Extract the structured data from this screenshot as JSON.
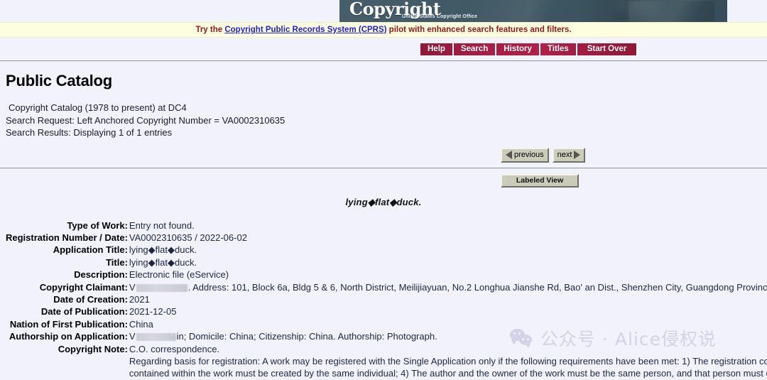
{
  "header": {
    "wordmark": "Copyright",
    "subtitle": "United States Copyright Office",
    "banner_color": "#3c5663"
  },
  "notice": {
    "prefix": "Try the ",
    "link_text": "Copyright Public Records System (CPRS)",
    "suffix": " pilot with enhanced search features and filters.",
    "background": "#fdfddf",
    "text_color": "#8b1a1a",
    "link_color": "#2222cc"
  },
  "nav": {
    "accent": "#a51e44",
    "buttons": [
      {
        "label": "Help"
      },
      {
        "label": "Search"
      },
      {
        "label": "History"
      },
      {
        "label": "Titles"
      },
      {
        "label": "Start Over"
      }
    ]
  },
  "page": {
    "title": "Public Catalog",
    "catalog_line": "Copyright Catalog (1978 to present) at DC4",
    "search_request": "Search Request: Left Anchored Copyright Number = VA0002310635",
    "search_results": "Search Results: Displaying 1 of 1 entries"
  },
  "pager": {
    "previous_label": "previous",
    "next_label": "next",
    "labeled_view": "Labeled View"
  },
  "record": {
    "title": "lying◆flat◆duck.",
    "fields": [
      {
        "label": "Type of Work:",
        "value": "Entry not found."
      },
      {
        "label": "Registration Number / Date:",
        "value": "VA0002310635 / 2022-06-02"
      },
      {
        "label": "Application Title:",
        "value": "lying◆flat◆duck."
      },
      {
        "label": "Title:",
        "value": "lying◆flat◆duck."
      },
      {
        "label": "Description:",
        "value": "Electronic file (eService)"
      },
      {
        "label": "Copyright Claimant:",
        "value_prefix": "V",
        "redacted": true,
        "redact_width": 72,
        "value_suffix": ". Address: 101, Block 6a, Bldg 5 & 6, North District, Meilijiayuan, No.2 Longhua Jianshe Rd, Bao'  an Dist., Shenzhen City, Guangdong Province, China."
      },
      {
        "label": "Date of Creation:",
        "value": "2021"
      },
      {
        "label": "Date of Publication:",
        "value": "2021-12-05"
      },
      {
        "label": "Nation of First Publication:",
        "value": "China"
      },
      {
        "label": "Authorship on Application:",
        "value_prefix": "V",
        "redacted": true,
        "redact_width": 56,
        "value_suffix": "in; Domicile: China; Citizenship: China. Authorship: Photograph."
      }
    ],
    "note_label": "Copyright Note:",
    "note_lines": [
      "C.O. correspondence.",
      "Regarding basis for registration: A work may be registered with the Single Application only if the following requirements have been met: 1) The registration covers one",
      "contained within the work must be created by the same individual; 4) The author and the owner of the work must be the same person, and that person must own all o"
    ]
  },
  "watermark": {
    "text": "公众号 · Alice侵权说",
    "icon": "wechat-icon",
    "color": "#d2d3e6"
  }
}
